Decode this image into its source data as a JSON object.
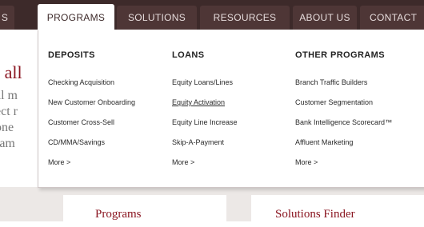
{
  "nav": {
    "tabs": [
      {
        "label": "S"
      },
      {
        "label": "PROGRAMS"
      },
      {
        "label": "SOLUTIONS"
      },
      {
        "label": "RESOURCES"
      },
      {
        "label": "ABOUT US"
      },
      {
        "label": "CONTACT"
      }
    ],
    "active_tab": "PROGRAMS"
  },
  "background": {
    "heading_fragment": "t all",
    "line_fragments": [
      "al m",
      "ect r",
      "one",
      "ram"
    ],
    "cards": [
      "Programs",
      "Solutions Finder"
    ]
  },
  "dropdown": {
    "columns": [
      {
        "heading": "DEPOSITS",
        "links": [
          "Checking Acquisition",
          "New Customer Onboarding",
          "Customer Cross-Sell",
          "CD/MMA/Savings",
          "More >"
        ]
      },
      {
        "heading": "LOANS",
        "links": [
          "Equity Loans/Lines",
          "Equity Activation",
          "Equity Line Increase",
          "Skip-A-Payment",
          "More >"
        ]
      },
      {
        "heading": "OTHER PROGRAMS",
        "links": [
          "Branch Traffic Builders",
          "Customer Segmentation",
          "Bank Intelligence Scorecard™",
          "Affluent Marketing",
          "More >"
        ]
      }
    ]
  },
  "colors": {
    "nav_background": "#3d2a2a",
    "nav_tab": "#4e3636",
    "accent_red": "#8a1520"
  }
}
